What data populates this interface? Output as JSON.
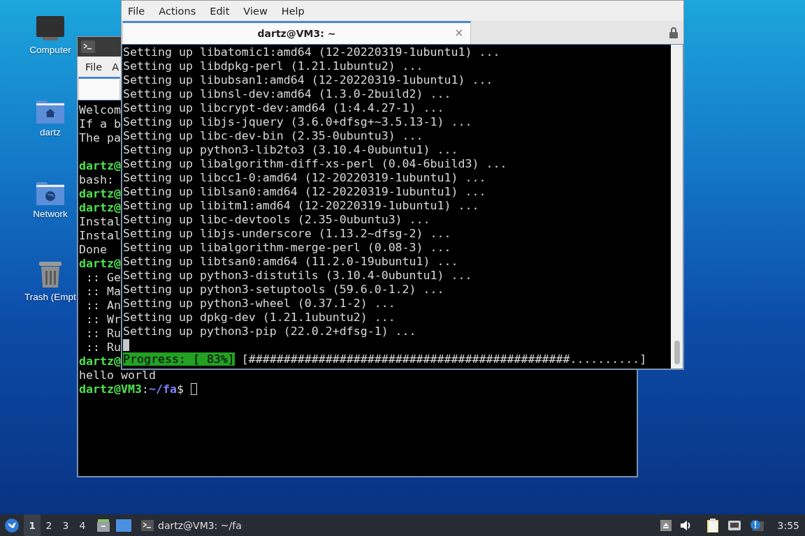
{
  "desktop_icons": [
    {
      "label": "Computer",
      "kind": "computer"
    },
    {
      "label": "dartz",
      "kind": "home"
    },
    {
      "label": "Network",
      "kind": "network"
    },
    {
      "label": "Trash (Empt",
      "kind": "trash"
    }
  ],
  "back_terminal": {
    "menu": [
      "File",
      "A"
    ],
    "lines": [
      {
        "text": "Welcom",
        "kind": "output"
      },
      {
        "text": "If a b",
        "kind": "output"
      },
      {
        "text": "The pa",
        "kind": "output"
      },
      {
        "kind": "blank"
      },
      {
        "text": "dartz@",
        "kind": "prompt"
      },
      {
        "text": "bash: ",
        "kind": "output"
      },
      {
        "text": "dartz@",
        "kind": "prompt"
      },
      {
        "text": "dartz@",
        "kind": "prompt"
      },
      {
        "text": "Instal",
        "kind": "output"
      },
      {
        "text": "Instal",
        "kind": "output"
      },
      {
        "text": "Done ",
        "kind": "output"
      },
      {
        "text": "dartz@",
        "kind": "prompt"
      },
      {
        "text": " :: Ge",
        "kind": "output"
      },
      {
        "text": " :: Ma",
        "kind": "output"
      },
      {
        "text": " :: An",
        "kind": "output"
      },
      {
        "text": " :: Wr",
        "kind": "output"
      },
      {
        "text": " :: Ru",
        "kind": "output"
      },
      {
        "text": " :: Ru",
        "kind": "output"
      },
      {
        "text": "dartz@",
        "kind": "prompt"
      },
      {
        "text": "hello world",
        "kind": "output"
      }
    ],
    "shell_prompt": {
      "user": "dartz@VM3",
      "separator": ":",
      "path": "~/fa",
      "sign": "$ ",
      "cursor": true
    }
  },
  "front_terminal": {
    "menu": [
      "File",
      "Actions",
      "Edit",
      "View",
      "Help"
    ],
    "tab": {
      "label": "dartz@VM3: ~",
      "close": "×",
      "selected": true
    },
    "lines": [
      "Setting up libatomic1:amd64 (12-20220319-1ubuntu1) ...",
      "Setting up libdpkg-perl (1.21.1ubuntu2) ...",
      "Setting up libubsan1:amd64 (12-20220319-1ubuntu1) ...",
      "Setting up libnsl-dev:amd64 (1.3.0-2build2) ...",
      "Setting up libcrypt-dev:amd64 (1:4.4.27-1) ...",
      "Setting up libjs-jquery (3.6.0+dfsg+~3.5.13-1) ...",
      "Setting up libc-dev-bin (2.35-0ubuntu3) ...",
      "Setting up python3-lib2to3 (3.10.4-0ubuntu1) ...",
      "Setting up libalgorithm-diff-xs-perl (0.04-6build3) ...",
      "Setting up libcc1-0:amd64 (12-20220319-1ubuntu1) ...",
      "Setting up liblsan0:amd64 (12-20220319-1ubuntu1) ...",
      "Setting up libitm1:amd64 (12-20220319-1ubuntu1) ...",
      "Setting up libc-devtools (2.35-0ubuntu3) ...",
      "Setting up libjs-underscore (1.13.2~dfsg-2) ...",
      "Setting up libalgorithm-merge-perl (0.08-3) ...",
      "Setting up libtsan0:amd64 (11.2.0-19ubuntu1) ...",
      "Setting up python3-distutils (3.10.4-0ubuntu1) ...",
      "Setting up python3-setuptools (59.6.0-1.2) ...",
      "Setting up python3-wheel (0.37.1-2) ...",
      "Setting up dpkg-dev (1.21.1ubuntu2) ...",
      "Setting up python3-pip (22.0.2+dfsg-1) ..."
    ],
    "cursor": true,
    "progress": {
      "label": "Progress: [ 83%]",
      "bar": "[##############################################..........]"
    }
  },
  "taskbar": {
    "workspaces": [
      {
        "label": "1",
        "selected": true
      },
      {
        "label": "2",
        "selected": false
      },
      {
        "label": "3",
        "selected": false
      },
      {
        "label": "4",
        "selected": false
      }
    ],
    "task": {
      "label": "dartz@VM3: ~/fa"
    },
    "clock": "3:55"
  }
}
